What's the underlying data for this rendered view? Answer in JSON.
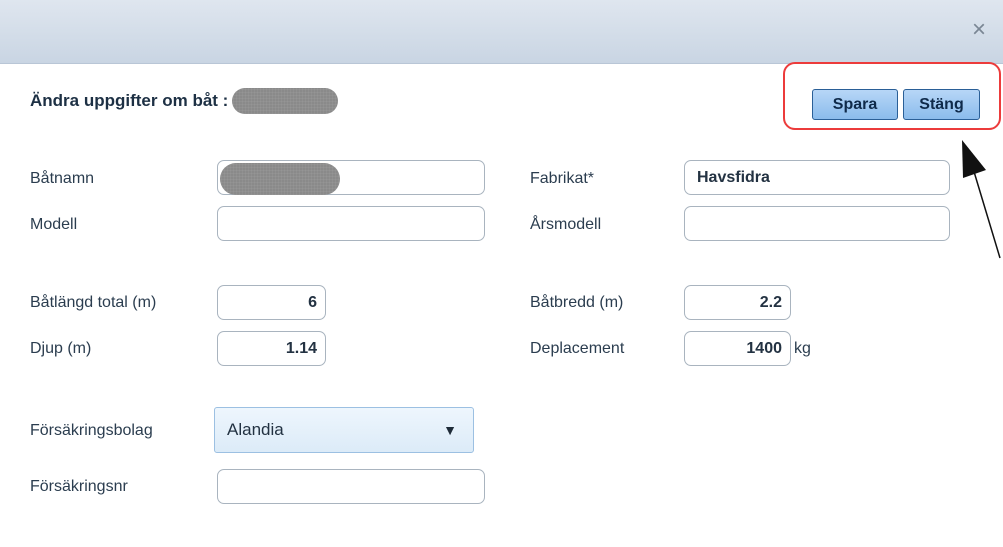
{
  "dialog": {
    "close_glyph": "×",
    "heading": "Ändra uppgifter om båt :"
  },
  "actions": {
    "save_label": "Spara",
    "close_label": "Stäng",
    "highlight_color": "#ec3b3b"
  },
  "fields": {
    "boat_name": {
      "label": "Båtnamn",
      "value": ""
    },
    "make": {
      "label": "Fabrikat*",
      "value": "Havsfidra"
    },
    "model": {
      "label": "Modell",
      "value": ""
    },
    "model_year": {
      "label": "Årsmodell",
      "value": ""
    },
    "length_total": {
      "label": "Båtlängd total (m)",
      "value": "6"
    },
    "beam": {
      "label": "Båtbredd (m)",
      "value": "2.2"
    },
    "depth": {
      "label": "Djup (m)",
      "value": "1.14"
    },
    "displacement": {
      "label": "Deplacement",
      "value": "1400",
      "unit": "kg"
    },
    "insurer": {
      "label": "Försäkringsbolag",
      "selected": "Alandia"
    },
    "policy_no": {
      "label": "Försäkringsnr",
      "value": ""
    }
  },
  "icons": {
    "dropdown_arrow": "▼"
  },
  "colors": {
    "button_bg": "#8bbcec",
    "titlebar": "#c9d5e3"
  }
}
